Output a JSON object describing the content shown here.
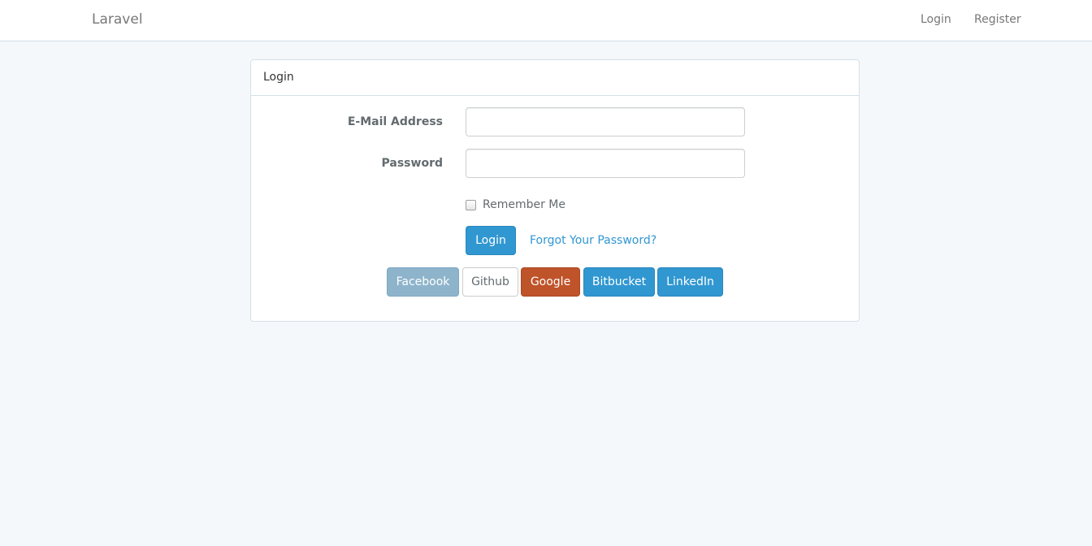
{
  "navbar": {
    "brand": "Laravel",
    "links": {
      "login": "Login",
      "register": "Register"
    }
  },
  "panel": {
    "heading": "Login",
    "email_label": "E-Mail Address",
    "email_value": "",
    "password_label": "Password",
    "password_value": "",
    "remember_label": "Remember Me",
    "remember_checked": false,
    "login_button": "Login",
    "forgot_link": "Forgot Your Password?"
  },
  "social": {
    "facebook": "Facebook",
    "github": "Github",
    "google": "Google",
    "bitbucket": "Bitbucket",
    "linkedin": "LinkedIn"
  },
  "colors": {
    "primary": "#3097d1",
    "facebook": "#8eb4cb",
    "google": "#bf5329",
    "background": "#f5f8fa"
  }
}
